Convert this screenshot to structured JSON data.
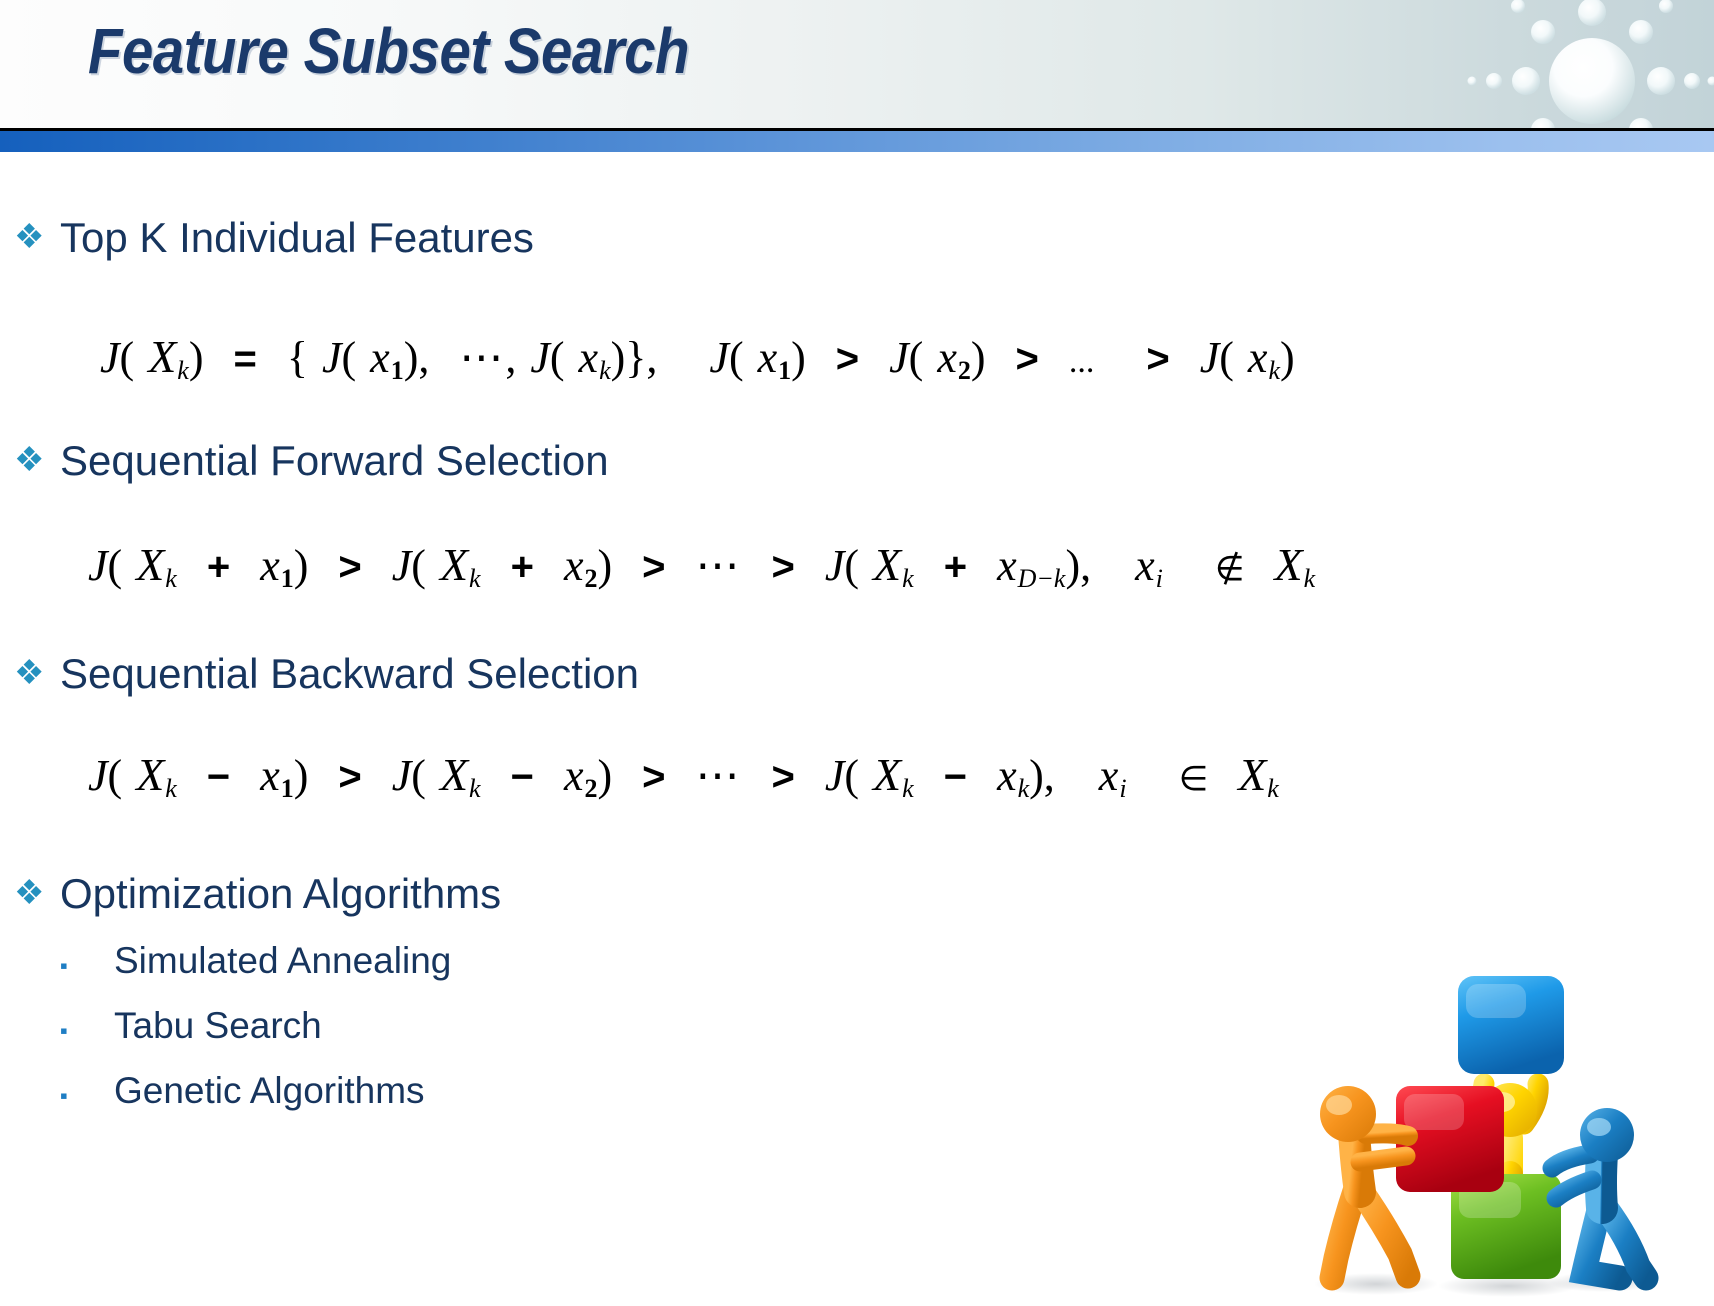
{
  "slide": {
    "title": "Feature Subset Search",
    "accent_dark": "#1b3a6b",
    "accent_bar_left": "#1560bd",
    "accent_bar_right": "#a8c8f2",
    "bullet_color": "#2591bf",
    "text_color": "#17355e"
  },
  "bullets": {
    "b1": "Top K Individual Features",
    "b2": "Sequential Forward Selection",
    "b3": "Sequential Backward Selection",
    "b4": "Optimization Algorithms",
    "marker": "❖",
    "sub_marker": "▪"
  },
  "sub_bullets": [
    {
      "label": "Simulated Annealing"
    },
    {
      "label": "Tabu Search"
    },
    {
      "label": "Genetic Algorithms"
    }
  ],
  "formulas": {
    "f1": {
      "plain": "J( X k ) = { J( x 1 ), ⋯ , J( x k )},   J( x 1 ) > J( x 2 ) > ...   > J( x k )",
      "parts": {
        "J": "J",
        "Xcap": "X",
        "xsmall": "x",
        "sub_k": "k",
        "sub_1": "1",
        "sub_2": "2",
        "eq": "=",
        "gt": ">",
        "lbrace": "{",
        "rbrace": "}",
        "lparen": "(",
        "rparen": ")",
        "comma": ",",
        "cdots": "⋯",
        "ldots": "..."
      }
    },
    "f2": {
      "plain": "J( X k + x 1 ) > J( X k + x 2 ) > ⋯ > J( X k + x D−k ),  x i  ∉ X k",
      "parts": {
        "plus": "+",
        "sub_Dk": "D−k",
        "sub_i": "i",
        "notin": "∉"
      }
    },
    "f3": {
      "plain": "J( X k − x 1 ) > J( X k − x 2 ) > ⋯ > J( X k − x k ),  x i  ∈ X k",
      "parts": {
        "minus": "−",
        "in": "∈"
      }
    }
  },
  "clipart": {
    "name": "teamwork-building-blocks",
    "figures": [
      {
        "name": "orange-figure",
        "color": "#f7941e"
      },
      {
        "name": "yellow-figure",
        "color": "#ffd400"
      },
      {
        "name": "blue-figure",
        "color": "#1b7fc4"
      }
    ],
    "blocks": [
      {
        "name": "blue-block",
        "color": "#2196e8"
      },
      {
        "name": "red-block",
        "color": "#e00d1f"
      },
      {
        "name": "green-block",
        "color": "#6bbf1f"
      }
    ]
  }
}
